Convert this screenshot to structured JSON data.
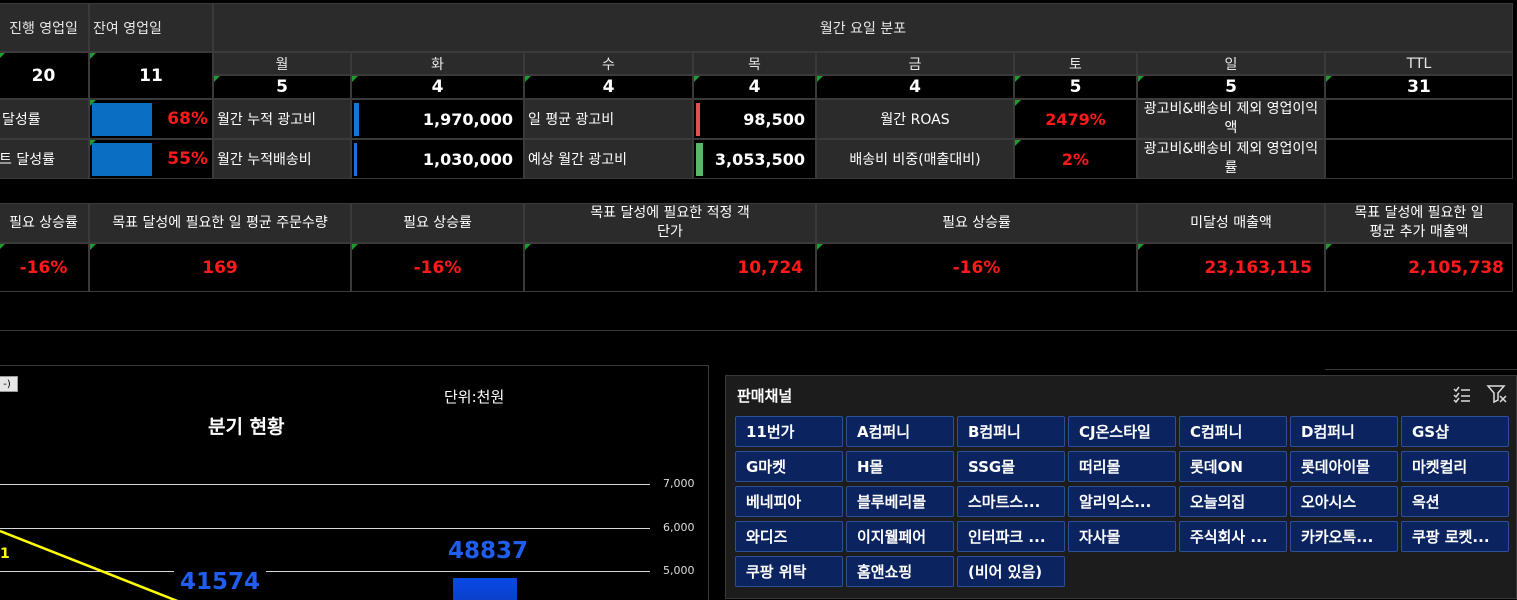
{
  "top": {
    "progress_days_label": "진행 영업일",
    "remaining_days_label": "잔여 영업일",
    "monthly_dist_label": "월간 요일 분포",
    "progress_days": "20",
    "remaining_days": "11",
    "weekdays": [
      "월",
      "화",
      "수",
      "목",
      "금",
      "토",
      "일",
      "TTL"
    ],
    "weekday_counts": [
      "5",
      "4",
      "4",
      "4",
      "4",
      "5",
      "5",
      "31"
    ]
  },
  "row1": {
    "label": "달성률",
    "pct": "68%",
    "pct_value": 0.68,
    "cum_ad_label": "월간 누적 광고비",
    "cum_ad_value": "1,970,000",
    "avg_ad_label": "일 평균 광고비",
    "avg_ad_value": "98,500",
    "roas_label": "월간 ROAS",
    "roas_value": "2479%",
    "profit_label": "광고비&배송비 제외 영업이익액",
    "profit_value": ""
  },
  "row2": {
    "label": "달성률",
    "pct": "55%",
    "pct_value": 0.55,
    "cum_ship_label": "월간 누적배송비",
    "cum_ship_value": "1,030,000",
    "est_ad_label": "예상 월간 광고비",
    "est_ad_value": "3,053,500",
    "ship_ratio_label": "배송비 비중(매출대비)",
    "ship_ratio_value": "2%",
    "profit_rate_label": "광고비&배송비 제외 영업이익률",
    "profit_rate_value": ""
  },
  "targets": {
    "headers": [
      "필요 상승률",
      "목표 달성에 필요한 일 평균 주문수량",
      "필요 상승률",
      "목표 달성에 필요한 적정 객단가",
      "필요 상승률",
      "미달성 매출액",
      "목표 달성에 필요한 일 평균 추가 매출액"
    ],
    "values": [
      "-16%",
      "169",
      "-16%",
      "10,724",
      "-16%",
      "23,163,115",
      "2,105,738"
    ]
  },
  "chart": {
    "button_label": "-)",
    "unit": "단위:천원",
    "title": "분기 현황",
    "y_ticks": [
      "7,000",
      "6,000",
      "5,000"
    ],
    "bar_label_1": "41574",
    "bar_label_2": "48837",
    "line_label": "1"
  },
  "channels": {
    "title": "판매채널",
    "items": [
      "11번가",
      "A컴퍼니",
      "B컴퍼니",
      "CJ온스타일",
      "C컴퍼니",
      "D컴퍼니",
      "GS샵",
      "G마켓",
      "H몰",
      "SSG몰",
      "떠리몰",
      "롯데ON",
      "롯데아이몰",
      "마켓컬리",
      "베네피아",
      "블루베리몰",
      "스마트스...",
      "알리익스...",
      "오늘의집",
      "오아시스",
      "옥션",
      "와디즈",
      "이지웰페어",
      "인터파크 ...",
      "자사몰",
      "주식회사 ...",
      "카카오톡...",
      "쿠팡 로켓...",
      "쿠팡 위탁",
      "홈앤쇼핑",
      "(비어 있음)"
    ]
  },
  "colors": {
    "accent_red": "#ff1a1a",
    "bar_blue": "#0a6fc2",
    "channel_bg": "#0b2460",
    "chart_blue_text": "#1f5ef0",
    "line_yellow": "#ffff00"
  }
}
